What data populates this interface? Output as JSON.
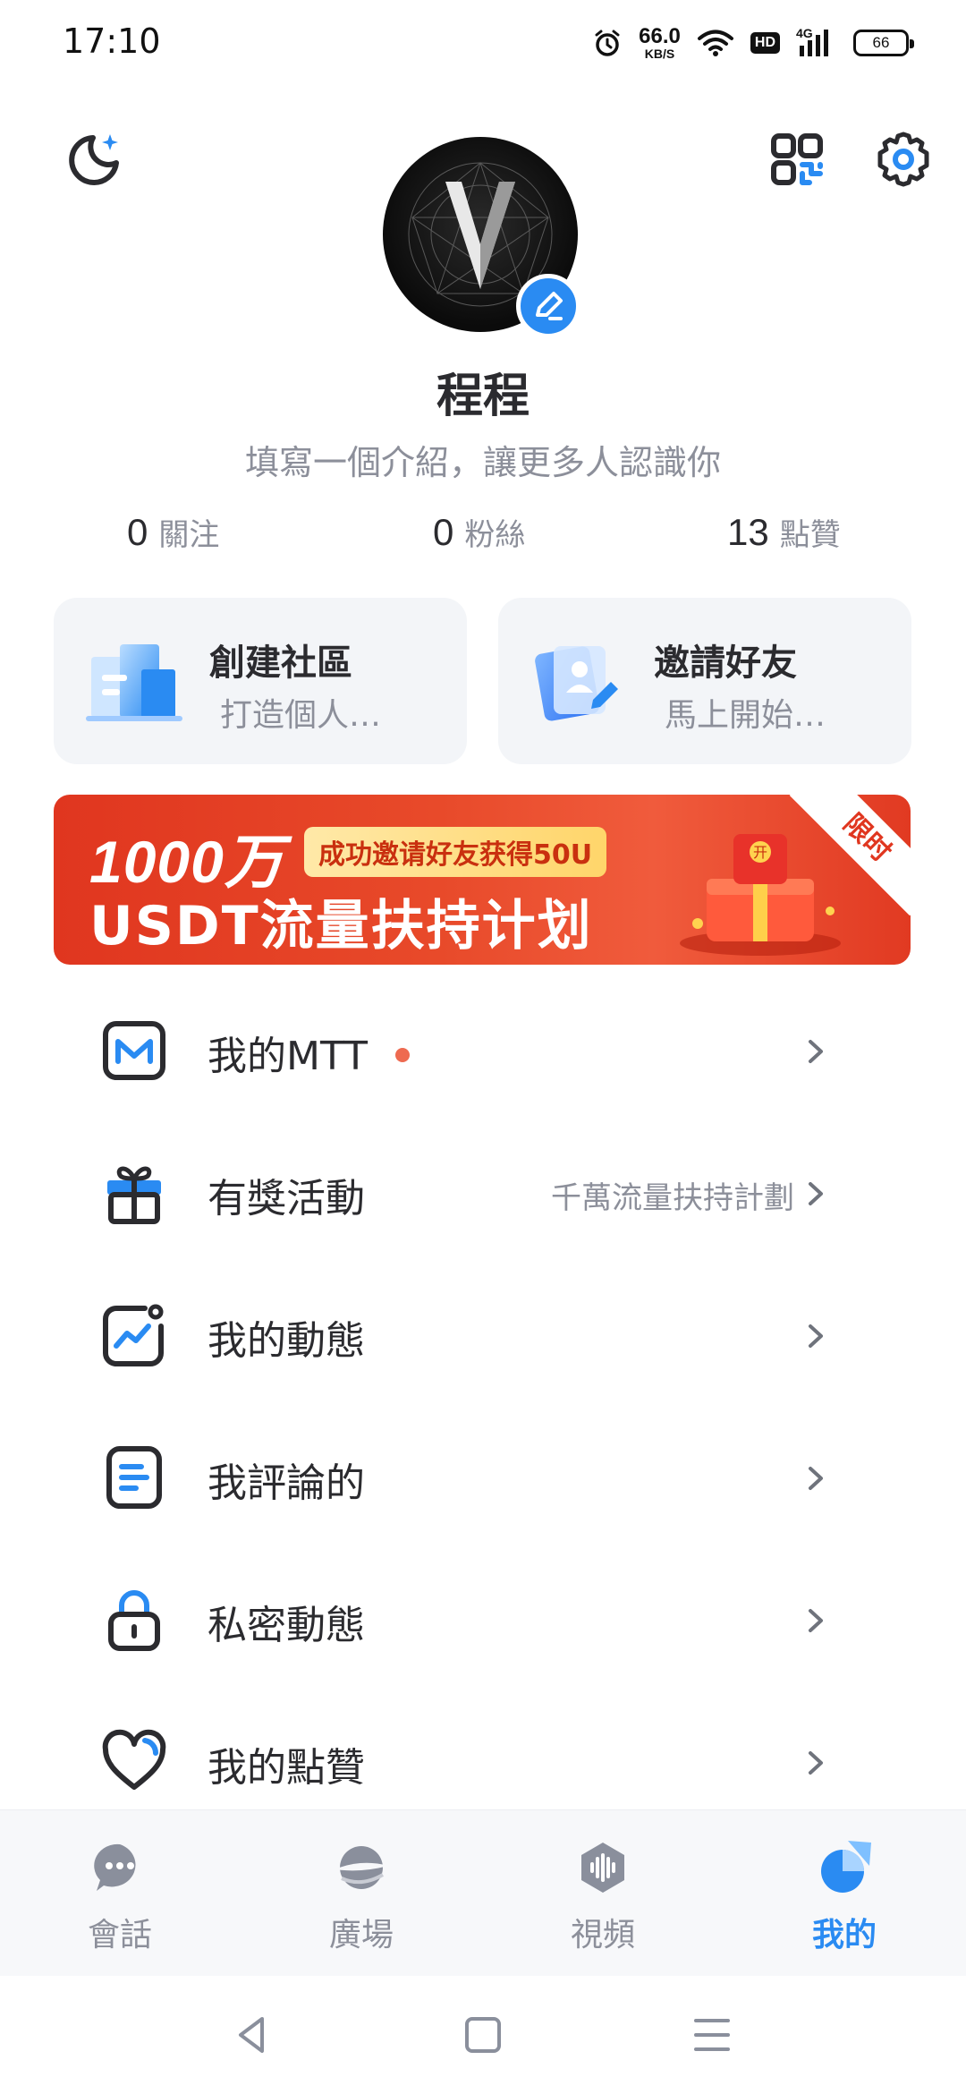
{
  "status_bar": {
    "time": "17:10",
    "net_speed_value": "66.0",
    "net_speed_unit": "KB/S",
    "hd_label": "HD",
    "signal_label": "4G",
    "battery_level": "66",
    "icons": [
      "alarm-icon",
      "wifi-icon",
      "hd-icon",
      "cellular-signal-icon",
      "battery-icon"
    ]
  },
  "header": {
    "icons": [
      "moon-icon",
      "qr-code-icon",
      "gear-icon"
    ]
  },
  "profile": {
    "username": "程程",
    "bio_placeholder": "填寫一個介紹，讓更多人認識你",
    "stats": {
      "following_count": "0",
      "following_label": "關注",
      "fans_count": "0",
      "fans_label": "粉絲",
      "likes_count": "13",
      "likes_label": "點贊"
    }
  },
  "cards": {
    "community_title": "創建社區",
    "community_sub": "打造個人…",
    "invite_title": "邀請好友",
    "invite_sub": "馬上開始…"
  },
  "banner": {
    "line1": "1000万",
    "tag": "成功邀请好友获得50U",
    "line2": "USDT流量扶持计划",
    "ribbon": "限时",
    "gift_char": "开"
  },
  "menu": {
    "items": [
      {
        "label": "我的MTT",
        "hint": "",
        "has_dot": true
      },
      {
        "label": "有獎活動",
        "hint": "千萬流量扶持計劃",
        "has_dot": false
      },
      {
        "label": "我的動態",
        "hint": "",
        "has_dot": false
      },
      {
        "label": "我評論的",
        "hint": "",
        "has_dot": false
      },
      {
        "label": "私密動態",
        "hint": "",
        "has_dot": false
      },
      {
        "label": "我的點贊",
        "hint": "",
        "has_dot": false
      }
    ]
  },
  "bottom_nav": {
    "items": [
      {
        "label": "會話",
        "icon": "chat-icon"
      },
      {
        "label": "廣場",
        "icon": "planet-icon"
      },
      {
        "label": "視頻",
        "icon": "video-icon"
      },
      {
        "label": "我的",
        "icon": "profile-pie-icon"
      }
    ],
    "active_index": 3
  },
  "colors": {
    "accent": "#2a8bf2",
    "text": "#2b2b2f",
    "muted": "#8c8f9a",
    "card_bg": "#f3f5f8",
    "banner_red": "#e0361f",
    "dot": "#ee6a50"
  }
}
